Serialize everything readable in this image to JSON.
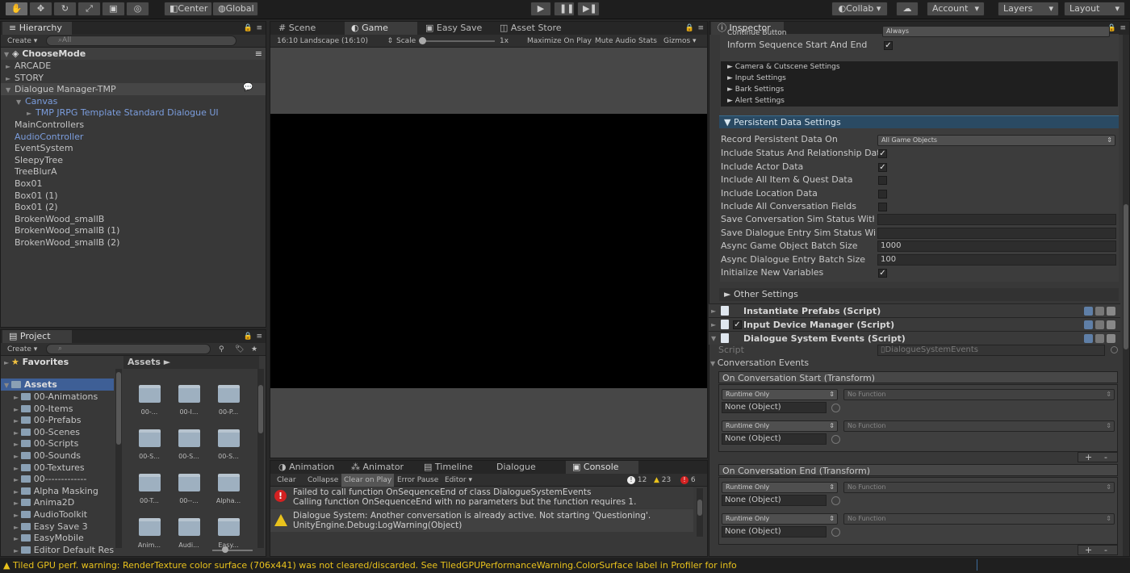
{
  "toolbar": {
    "tools": [
      "hand-tool-icon",
      "move-tool-icon",
      "rotate-tool-icon",
      "scale-tool-icon",
      "rect-tool-icon",
      "transform-tool-icon"
    ],
    "pivot_label": "Center",
    "global_label": "Global",
    "collab_label": "Collab ▾",
    "account_label": "Account",
    "layers_label": "Layers",
    "layout_label": "Layout"
  },
  "hierarchy": {
    "tab": "Hierarchy",
    "create_label": "Create ▾",
    "search_placeholder": "All",
    "scene": "ChooseMode",
    "items": [
      {
        "label": "ARCADE",
        "indent": 1,
        "tri": "►",
        "blue": false
      },
      {
        "label": "STORY",
        "indent": 1,
        "tri": "►",
        "blue": false
      },
      {
        "label": "Dialogue Manager-TMP",
        "indent": 1,
        "tri": "▼",
        "blue": false,
        "selected": true
      },
      {
        "label": "Canvas",
        "indent": 2,
        "tri": "▼",
        "blue": true
      },
      {
        "label": "TMP JRPG Template Standard Dialogue UI",
        "indent": 3,
        "tri": "►",
        "blue": true
      },
      {
        "label": "MainControllers",
        "indent": 1,
        "tri": "",
        "blue": false
      },
      {
        "label": "AudioController",
        "indent": 1,
        "tri": "",
        "blue": true
      },
      {
        "label": "EventSystem",
        "indent": 1,
        "tri": "",
        "blue": false
      },
      {
        "label": "SleepyTree",
        "indent": 1,
        "tri": "",
        "blue": false
      },
      {
        "label": "TreeBlurA",
        "indent": 1,
        "tri": "",
        "blue": false
      },
      {
        "label": "Box01",
        "indent": 1,
        "tri": "",
        "blue": false
      },
      {
        "label": "Box01 (1)",
        "indent": 1,
        "tri": "",
        "blue": false
      },
      {
        "label": "Box01 (2)",
        "indent": 1,
        "tri": "",
        "blue": false
      },
      {
        "label": "BrokenWood_smallB",
        "indent": 1,
        "tri": "",
        "blue": false
      },
      {
        "label": "BrokenWood_smallB (1)",
        "indent": 1,
        "tri": "",
        "blue": false
      },
      {
        "label": "BrokenWood_smallB (2)",
        "indent": 1,
        "tri": "",
        "blue": false
      }
    ]
  },
  "project": {
    "tab": "Project",
    "create_label": "Create ▾",
    "favorites": "Favorites",
    "assets": "Assets",
    "breadcrumb": "Assets ►",
    "folders": [
      "00-Animations",
      "00-Items",
      "00-Prefabs",
      "00-Scenes",
      "00-Scripts",
      "00-Sounds",
      "00-Textures",
      "00-------------",
      "Alpha Masking",
      "Anima2D",
      "AudioToolkit",
      "Easy Save 3",
      "EasyMobile",
      "Editor Default Reso"
    ],
    "grid": [
      "00-...",
      "00-I...",
      "00-P...",
      "00-S...",
      "00-S...",
      "00-S...",
      "00-T...",
      "00--...",
      "Alpha...",
      "Anim...",
      "Audi...",
      "Easy..."
    ]
  },
  "game": {
    "tabs": [
      "Scene",
      "Game",
      "Easy Save",
      "Asset Store"
    ],
    "aspect": "16:10 Landscape (16:10)",
    "scale_label": "Scale",
    "scale_value": "1x",
    "maximize": "Maximize On Play",
    "mute": "Mute Audio",
    "stats": "Stats",
    "gizmos": "Gizmos"
  },
  "console": {
    "tabs": [
      "Animation",
      "Animator",
      "Timeline",
      "Dialogue",
      "Console"
    ],
    "buttons": [
      "Clear",
      "Collapse",
      "Clear on Play",
      "Error Pause",
      "Editor ▾"
    ],
    "info_count": "12",
    "warn_count": "23",
    "error_count": "6",
    "entries": [
      {
        "type": "error",
        "line1": "Failed to call function OnSequenceEnd of class DialogueSystemEvents",
        "line2": "Calling function OnSequenceEnd with no parameters but the function requires 1."
      },
      {
        "type": "warning",
        "line1": "Dialogue System: Another conversation is already active. Not starting 'Questioning'.",
        "line2": "UnityEngine.Debug:LogWarning(Object)"
      }
    ]
  },
  "inspector": {
    "tab": "Inspector",
    "top_label": "Continue Button",
    "top_value": "Always",
    "inform_label": "Inform Sequence Start And End",
    "subsections": [
      "Camera & Cutscene Settings",
      "Input Settings",
      "Bark Settings",
      "Alert Settings"
    ],
    "persistent_header": "Persistent Data Settings",
    "record_label": "Record Persistent Data On",
    "record_value": "All Game Objects",
    "checks": [
      {
        "label": "Include Status And Relationship Data",
        "checked": true
      },
      {
        "label": "Include Actor Data",
        "checked": true
      },
      {
        "label": "Include All Item & Quest Data",
        "checked": false
      },
      {
        "label": "Include Location Data",
        "checked": false
      },
      {
        "label": "Include All Conversation Fields",
        "checked": false
      }
    ],
    "save_conv_label": "Save Conversation Sim Status With F",
    "save_entry_label": "Save Dialogue Entry Sim Status With",
    "async_go_label": "Async Game Object Batch Size",
    "async_go_value": "1000",
    "async_de_label": "Async Dialogue Entry Batch Size",
    "async_de_value": "100",
    "init_label": "Initialize New Variables",
    "other_settings": "Other Settings",
    "components": [
      {
        "label": "Instantiate Prefabs (Script)",
        "toggle": false
      },
      {
        "label": "Input Device Manager (Script)",
        "toggle": true
      },
      {
        "label": "Dialogue System Events (Script)",
        "toggle": false
      }
    ],
    "script_label": "Script",
    "script_value": "DialogueSystemEvents",
    "conv_events": "Conversation Events",
    "on_start": "On Conversation Start (Transform)",
    "on_end": "On Conversation End (Transform)",
    "runtime_only": "Runtime Only",
    "no_function": "No Function",
    "none_object": "None (Object)",
    "plus": "+",
    "minus": "-"
  },
  "status_bar": {
    "message": "Tiled GPU perf. warning: RenderTexture color surface (706x441) was not cleared/discarded. See TiledGPUPerformanceWarning.ColorSurface label in Profiler for info"
  }
}
